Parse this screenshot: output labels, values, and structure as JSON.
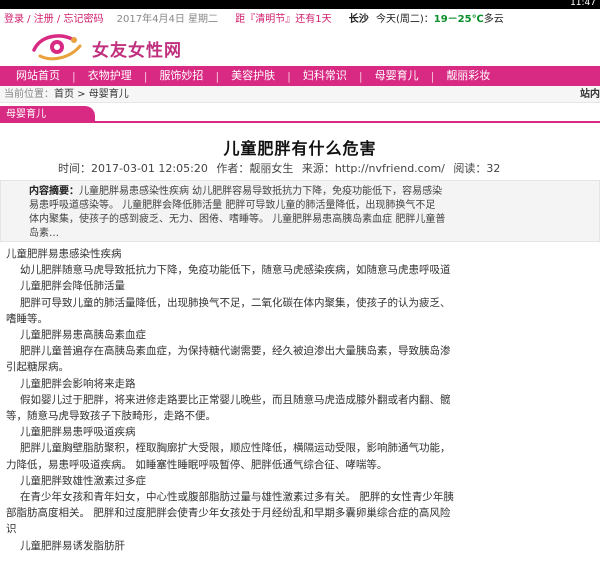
{
  "status_bar": {
    "time": "11:47"
  },
  "top_bar": {
    "login": "登录",
    "register": "注册",
    "forgot": "忘记密码",
    "date": "2017年4月4日 星期二",
    "festival_prefix": "距『清明节』还有1天",
    "city": "长沙",
    "today": "今天(周二)：",
    "temp": "19－25℃",
    "weather": "多云"
  },
  "logo": {
    "text": "女友女性网"
  },
  "nav": {
    "items": [
      "网站首页",
      "衣物护理",
      "服饰妙招",
      "美容护肤",
      "妇科常识",
      "母婴育儿",
      "靓丽彩妆"
    ]
  },
  "breadcrumb": {
    "label": "当前位置：",
    "home": "首页",
    "sep": " > ",
    "current": "母婴育儿",
    "right_text": "站内"
  },
  "section": {
    "tab_label": "母婴育儿"
  },
  "article": {
    "title": "儿童肥胖有什么危害",
    "meta": {
      "time": "时间：2017-03-01 12:05:20",
      "author": "作者：靓丽女生",
      "source": "来源：http://nvfriend.com/",
      "reads": "阅读：32"
    },
    "summary_label": "内容摘要：",
    "summary_lines": [
      "儿童肥胖易患感染性疾病 幼儿肥胖容易导致抵抗力下降，免疫功能低下，容易感染",
      "易患呼吸道感染等。 儿童肥胖会降低肺活量 肥胖可导致儿童的肺活量降低，出现肺换气不足",
      "体内聚集，使孩子的感到疲乏、无力、困倦、嗜睡等。 儿童肥胖易患高胰岛素血症 肥胖儿童普",
      "岛素…"
    ],
    "paragraphs": [
      {
        "cls": "c",
        "text": "儿童肥胖易患感染性疾病"
      },
      {
        "cls": "h",
        "text": "幼儿肥胖随意马虎导致抵抗力下降，免疫功能低下，随意马虎感染疾病，如随意马虎患呼吸道"
      },
      {
        "cls": "h",
        "text": "儿童肥胖会降低肺活量"
      },
      {
        "cls": "h",
        "text": "肥胖可导致儿童的肺活量降低，出现肺换气不足，二氧化碳在体内聚集，使孩子的认为疲乏、"
      },
      {
        "cls": "c",
        "text": "嗜睡等。"
      },
      {
        "cls": "h",
        "text": "儿童肥胖易患高胰岛素血症"
      },
      {
        "cls": "h",
        "text": "肥胖儿童普遍存在高胰岛素血症，为保持糖代谢需要，经久被迫渗出大量胰岛素，导致胰岛渗"
      },
      {
        "cls": "c",
        "text": "引起糖尿病。"
      },
      {
        "cls": "h",
        "text": "儿童肥胖会影响将来走路"
      },
      {
        "cls": "h",
        "text": "假如婴儿过于肥胖，将来进修走路要比正常婴儿晚些，而且随意马虎造成膝外翻或者内翻、髋"
      },
      {
        "cls": "c",
        "text": "等，随意马虎导致孩子下肢畸形，走路不便。"
      },
      {
        "cls": "h",
        "text": "儿童肥胖易患呼吸道疾病"
      },
      {
        "cls": "h",
        "text": "肥胖儿童胸壁脂肪聚积，桎取胸廓扩大受限，顺应性降低，横隔运动受限，影响肺通气功能，"
      },
      {
        "cls": "c",
        "text": "力降低，易患呼吸道疾病。 如睡塞性睡眠呼吸暂停、肥胖低通气综合征、哮喘等。"
      },
      {
        "cls": "h",
        "text": "儿童肥胖致雄性激素过多症"
      },
      {
        "cls": "h",
        "text": "在青少年女孩和青年妇女，中心性或腹部脂肪过量与雄性激素过多有关。 肥胖的女性青少年胰"
      },
      {
        "cls": "c",
        "text": "部脂肪高度相关。 肥胖和过度肥胖会使青少年女孩处于月经纷乱和早期多囊卵巢综合症的高风险"
      },
      {
        "cls": "c",
        "text": "识"
      },
      {
        "cls": "h",
        "text": "儿童肥胖易诱发脂肪肝"
      }
    ]
  },
  "colors": {
    "brand": "#d82a82",
    "logo_text": "#c0307f",
    "temp_green": "#0a8f2a"
  }
}
